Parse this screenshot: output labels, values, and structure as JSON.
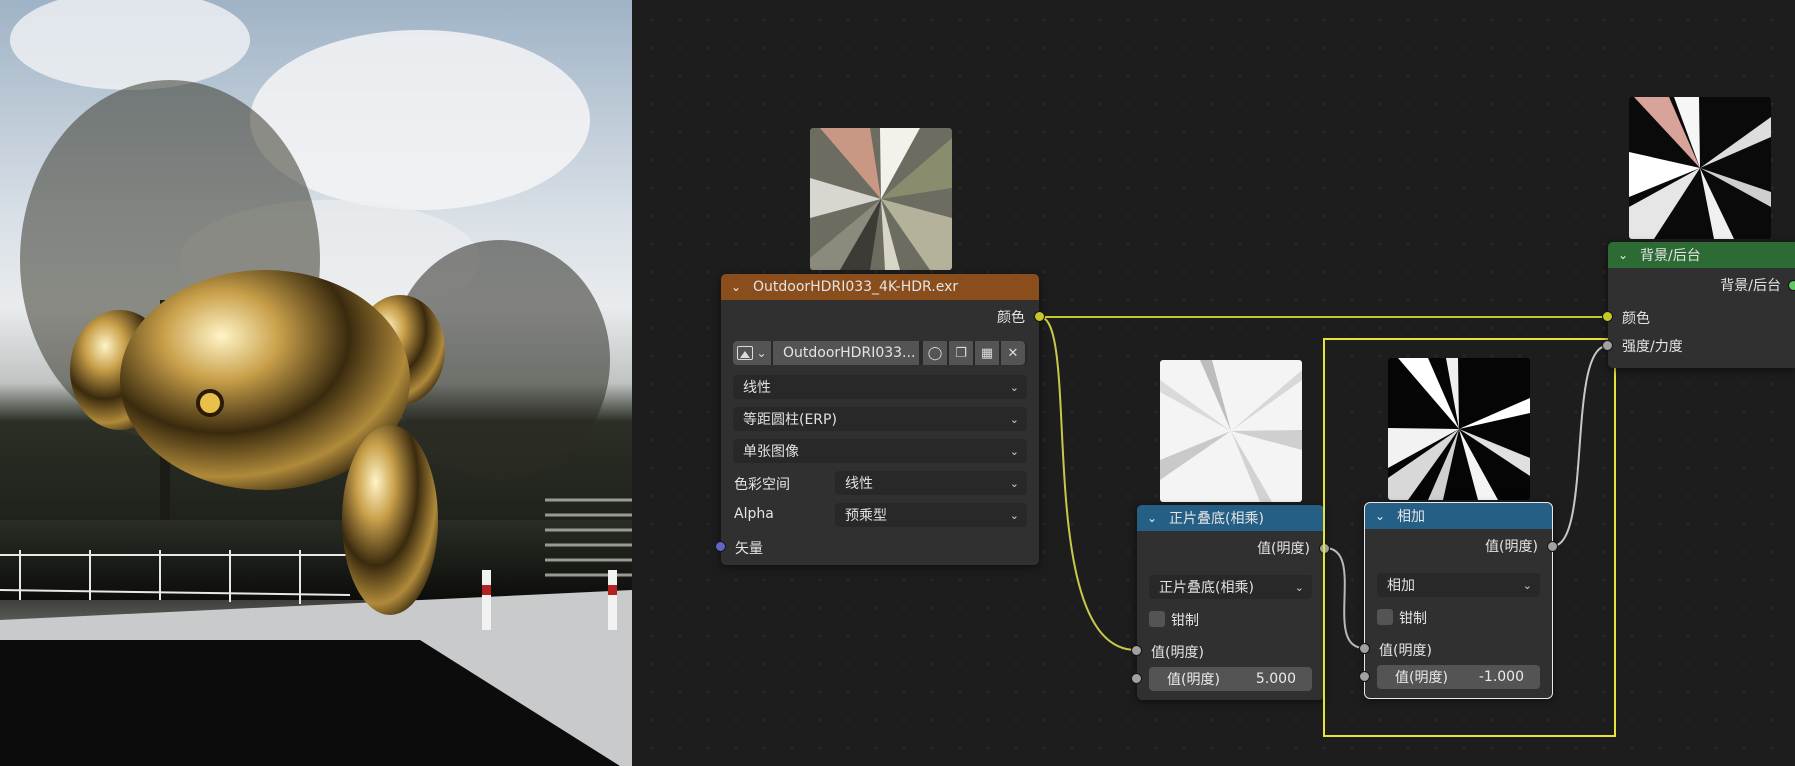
{
  "image_texture_node": {
    "title": "OutdoorHDRI033_4K-HDR.exr",
    "output_color": "颜色",
    "image_name": "OutdoorHDRI033...",
    "interpolation": "线性",
    "projection": "等距圆柱(ERP)",
    "source": "单张图像",
    "color_space_label": "色彩空间",
    "color_space_value": "线性",
    "alpha_label": "Alpha",
    "alpha_value": "预乘型",
    "input_vector": "矢量"
  },
  "multiply_node": {
    "title": "正片叠底(相乘)",
    "output_value": "值(明度)",
    "operation": "正片叠底(相乘)",
    "clamp_label": "钳制",
    "input_value": "值(明度)",
    "field_label": "值(明度)",
    "field_value": "5.000"
  },
  "add_node": {
    "title": "相加",
    "output_value": "值(明度)",
    "operation": "相加",
    "clamp_label": "钳制",
    "input_value": "值(明度)",
    "field_label": "值(明度)",
    "field_value": "-1.000"
  },
  "background_node": {
    "title": "背景/后台",
    "output_background": "背景/后台",
    "input_color": "颜色",
    "input_strength": "强度/力度"
  },
  "icons": [
    "chevron-down-icon",
    "image-browse-icon",
    "shield-icon",
    "duplicate-icon",
    "folder-icon",
    "close-icon"
  ],
  "colors": {
    "texture_header": "#8a4d1c",
    "math_header": "#255f86",
    "output_header": "#2c6b34",
    "color_socket": "#c7c729",
    "value_socket": "#a1a1a1",
    "vector_socket": "#6363c7",
    "shader_socket": "#63c763",
    "frame_highlight": "#e6e33a"
  }
}
